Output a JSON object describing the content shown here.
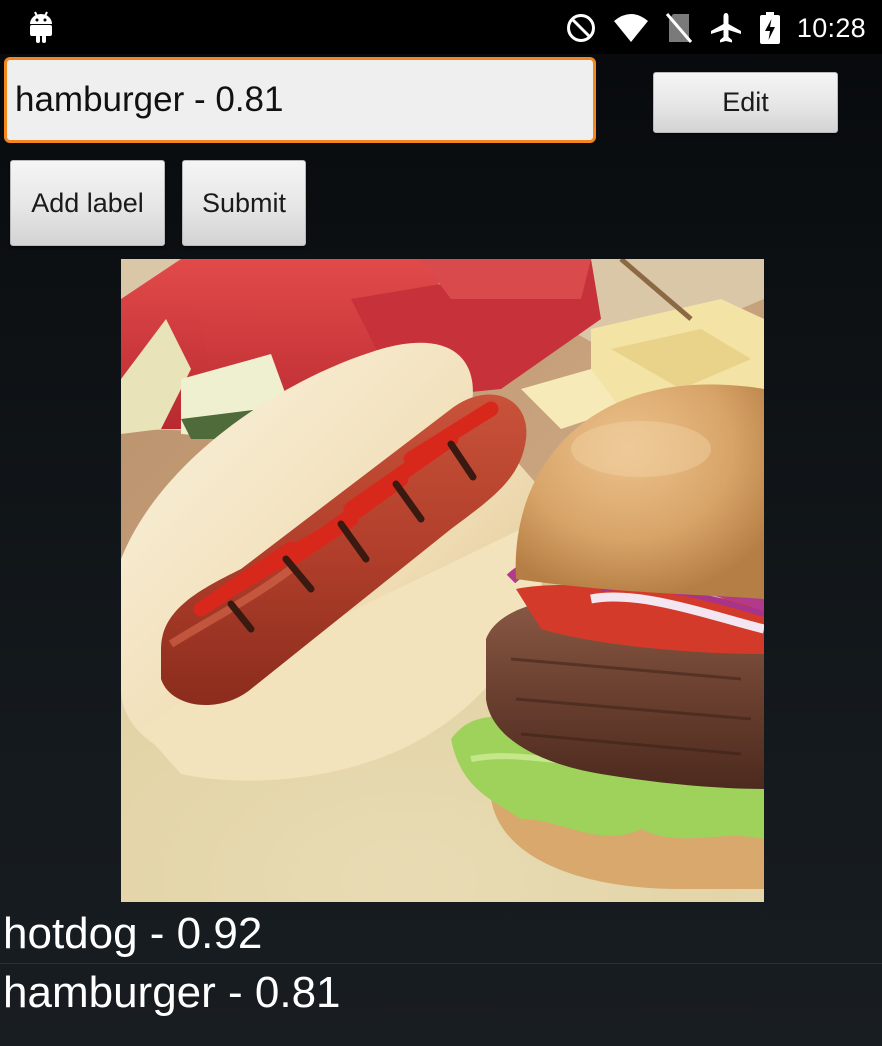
{
  "status_bar": {
    "time": "10:28",
    "icons": [
      "android-icon",
      "do-not-disturb-icon",
      "wifi-icon",
      "no-sim-icon",
      "airplane-mode-icon",
      "battery-charging-icon"
    ]
  },
  "label_editor": {
    "input_value": "hamburger - 0.81",
    "edit_label": "Edit",
    "add_label": "Add label",
    "submit_label": "Submit",
    "accent_color": "#f3861f"
  },
  "photo": {
    "subject": "hotdog-and-hamburger-photo"
  },
  "results": [
    {
      "text": "hotdog - 0.92"
    },
    {
      "text": "hamburger - 0.81"
    }
  ]
}
